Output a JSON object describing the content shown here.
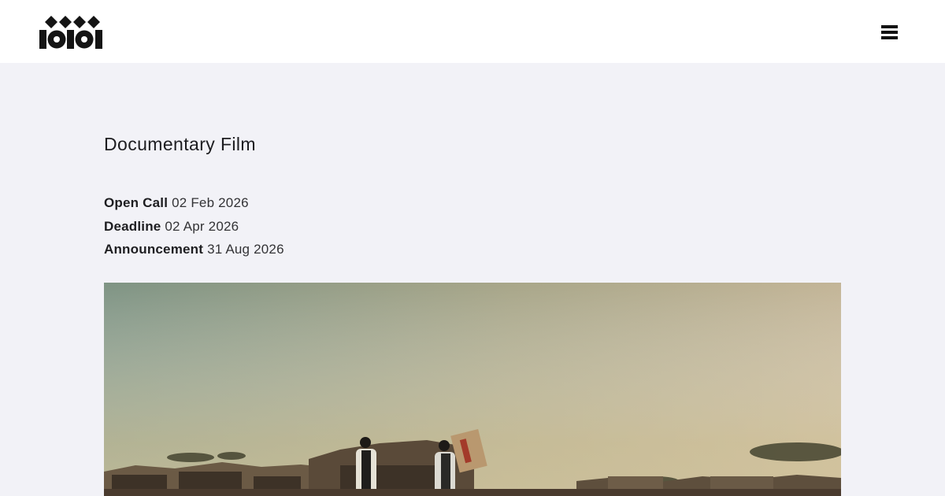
{
  "header": {
    "logo_icon": "ioioi-logo-icon",
    "menu_icon": "hamburger-menu-icon"
  },
  "page": {
    "title": "Documentary Film",
    "dates": [
      {
        "label": "Open Call",
        "value": "02 Feb 2026"
      },
      {
        "label": "Deadline",
        "value": "02 Apr 2026"
      },
      {
        "label": "Announcement",
        "value": "31 Aug 2026"
      }
    ]
  },
  "hero": {
    "description_icon": "desert-village-photo",
    "colors": {
      "sky_top_left": "#7f9484",
      "sky_top_right": "#c3b597",
      "sky_bottom": "#d7c8a0",
      "ground": "#4a3b2e"
    }
  }
}
